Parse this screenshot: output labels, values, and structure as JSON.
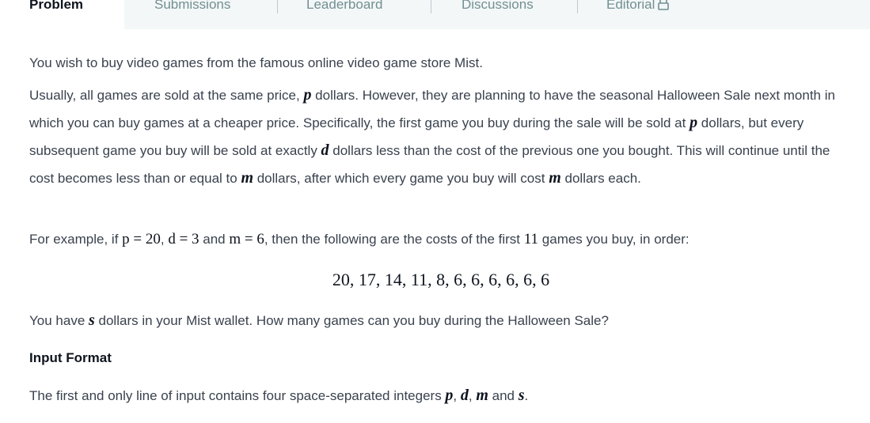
{
  "tabs": {
    "active": "Problem",
    "items": [
      "Submissions",
      "Leaderboard",
      "Discussions",
      "Editorial"
    ],
    "editorial_icon": "lock-icon"
  },
  "problem": {
    "p1": "You wish to buy video games from the famous online video game store Mist.",
    "p2_a": "Usually, all games are sold at the same price, ",
    "var_p": "p",
    "p2_b": " dollars. However, they are planning to have the seasonal Halloween Sale next month in which you can buy games at a cheaper price. Specifically, the first game you buy during the sale will be sold at ",
    "p2_c": " dollars, but every subsequent game you buy will be sold at exactly ",
    "var_d": "d",
    "p2_d": " dollars less than the cost of the previous one you bought. This will continue until the cost becomes less than or equal to ",
    "var_m": "m",
    "p2_e": " dollars, after which every game you buy will cost ",
    "p2_f": " dollars each.",
    "p3_a": "For example, if ",
    "p3_eq_p": "p = 20",
    "p3_comma1": ", ",
    "p3_eq_d": "d = 3",
    "p3_and": " and ",
    "p3_eq_m": "m = 6",
    "p3_b": ", then the following are the costs of the first ",
    "p3_count": "11",
    "p3_c": " games you buy, in order:",
    "sequence": "20, 17, 14, 11, 8, 6, 6, 6, 6, 6, 6",
    "p4_a": "You have ",
    "var_s": "s",
    "p4_b": " dollars in your Mist wallet. How many games can you buy during the Halloween Sale?",
    "input_heading": "Input Format",
    "p5_a": "The first and only line of input contains four space-separated integers ",
    "p5_sep1": ", ",
    "p5_sep2": ", ",
    "p5_and": " and ",
    "p5_end": "."
  }
}
